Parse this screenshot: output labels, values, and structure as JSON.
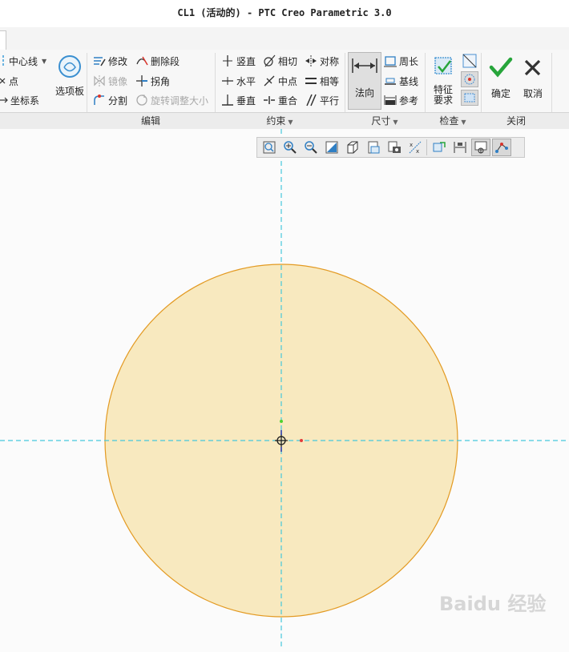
{
  "window": {
    "title": "CL1 (活动的) - PTC Creo Parametric 3.0"
  },
  "ribbon": {
    "sketch_group": {
      "centerline": "中心线",
      "point": "点",
      "coordinate_system": "坐标系",
      "palette": "选项板"
    },
    "edit_group": {
      "label": "编辑",
      "modify": "修改",
      "delete_segment": "删除段",
      "mirror": "镜像",
      "corner": "拐角",
      "divide": "分割",
      "rotate_resize": "旋转调整大小"
    },
    "constrain_group": {
      "label": "约束",
      "vertical": "竖直",
      "tangent": "相切",
      "symmetric": "对称",
      "horizontal": "水平",
      "midpoint": "中点",
      "equal": "相等",
      "perpendicular": "垂直",
      "coincident": "重合",
      "parallel": "平行"
    },
    "dimension_group": {
      "label": "尺寸",
      "normal": "法向",
      "perimeter": "周长",
      "baseline": "基线",
      "reference": "参考"
    },
    "inspect_group": {
      "label": "检查",
      "feature_requirements": "特征要求"
    },
    "close_group": {
      "label": "关闭",
      "ok": "确定",
      "cancel": "取消"
    }
  },
  "colors": {
    "circle_fill": "#f8e9bf",
    "circle_stroke": "#e39a22",
    "centerline": "#45c8dc",
    "ok_check": "#27a53b"
  },
  "watermark": {
    "text": "Baidu 经验"
  }
}
